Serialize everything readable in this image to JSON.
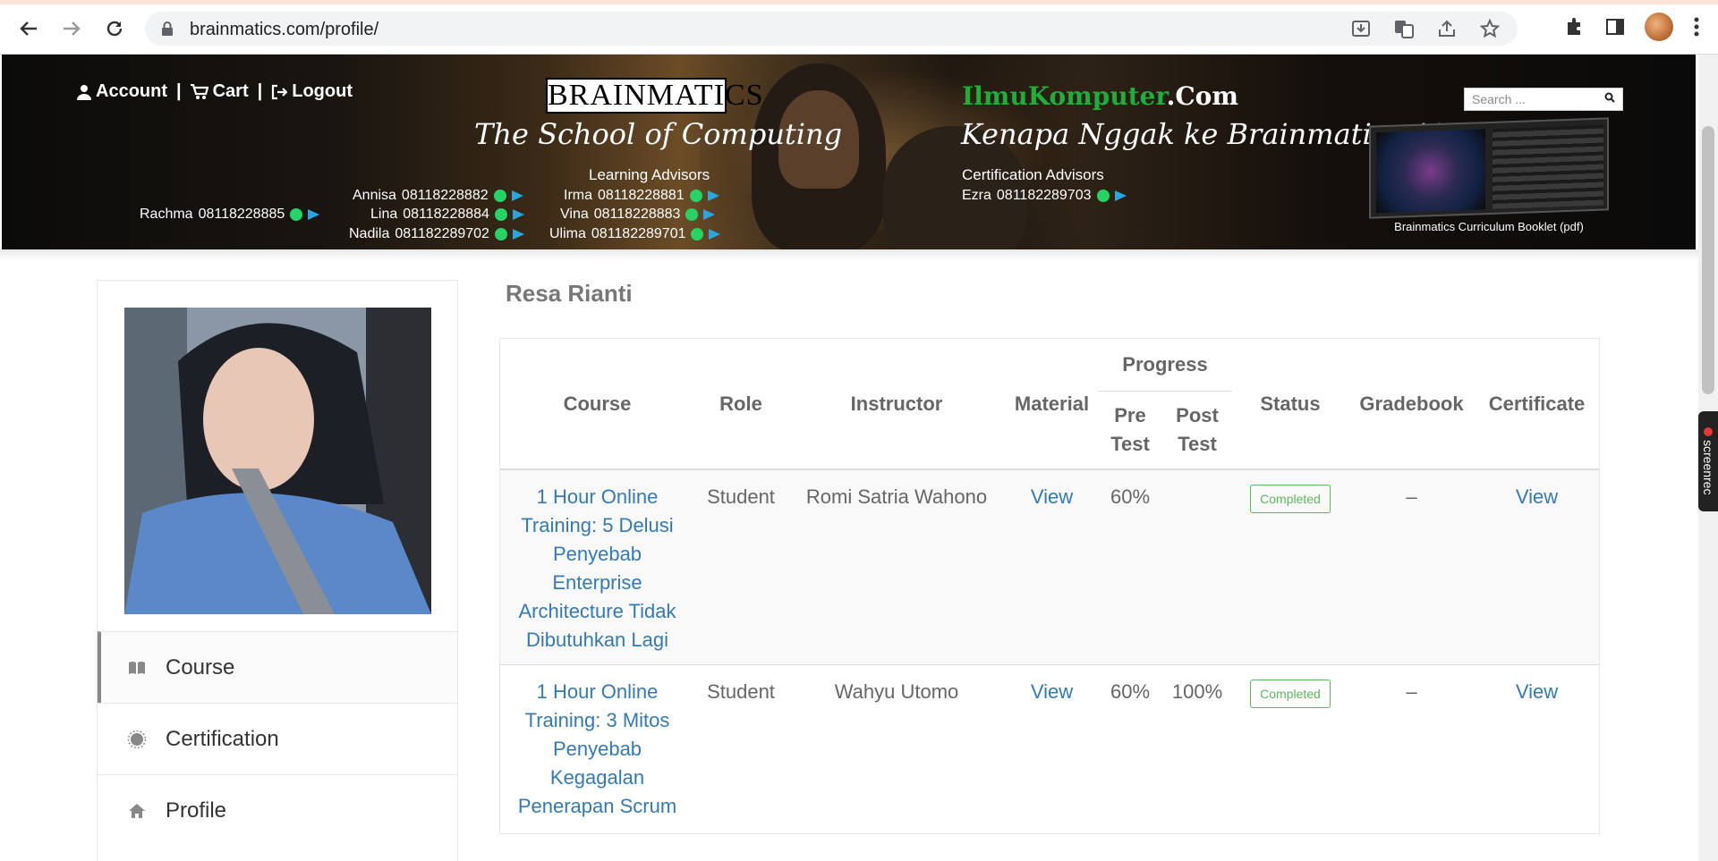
{
  "browser": {
    "url": "brainmatics.com/profile/",
    "icons": [
      "back-icon",
      "forward-icon",
      "reload-icon",
      "lock-icon",
      "install-icon",
      "translate-icon",
      "share-icon",
      "bookmark-star-icon",
      "extensions-icon",
      "side-panel-icon",
      "profile-avatar",
      "menu-icon"
    ]
  },
  "header": {
    "account": "Account",
    "cart": "Cart",
    "logout": "Logout",
    "sep1": "|",
    "sep2": "|",
    "logo": "BRAINMATICS",
    "tagline_left": "The School of Computing",
    "ilmu_green": "IlmuKomputer",
    "ilmu_white": ".Com",
    "tagline_right": "Kenapa Nggak ke Brainmatics Aja?",
    "learning_title": "Learning Advisors",
    "advisors": [
      {
        "name": "Annisa",
        "phone": "08118228882"
      },
      {
        "name": "Lina",
        "phone": "08118228884"
      },
      {
        "name": "Nadila",
        "phone": "081182289702"
      },
      {
        "name": "Irma",
        "phone": "08118228881"
      },
      {
        "name": "Vina",
        "phone": "08118228883"
      },
      {
        "name": "Ulima",
        "phone": "081182289701"
      },
      {
        "name": "Rachma",
        "phone": "08118228885"
      }
    ],
    "cert_title": "Certification Advisors",
    "cert_advisor": {
      "name": "Ezra",
      "phone": "081182289703"
    },
    "search_placeholder": "Search ...",
    "booklet_caption": "Brainmatics Curriculum Booklet (pdf)"
  },
  "sidebar": {
    "menu": [
      {
        "label": "Course",
        "icon": "book-icon"
      },
      {
        "label": "Certification",
        "icon": "certificate-icon"
      },
      {
        "label": "Profile",
        "icon": "home-icon"
      }
    ]
  },
  "profile": {
    "name": "Resa Rianti"
  },
  "table": {
    "headers": {
      "course": "Course",
      "role": "Role",
      "instructor": "Instructor",
      "material": "Material",
      "progress": "Progress",
      "pre_test_1": "Pre",
      "pre_test_2": "Test",
      "post_test_1": "Post",
      "post_test_2": "Test",
      "status": "Status",
      "gradebook": "Gradebook",
      "certificate": "Certificate"
    },
    "rows": [
      {
        "course_lines": [
          "1 Hour Online",
          "Training: 5 Delusi",
          "Penyebab",
          "Enterprise",
          "Architecture Tidak",
          "Dibutuhkan Lagi"
        ],
        "role": "Student",
        "instructor": "Romi Satria Wahono",
        "material": "View",
        "pre_test": "60%",
        "post_test": "",
        "status": "Completed",
        "gradebook": "–",
        "certificate": "View"
      },
      {
        "course_lines": [
          "1 Hour Online",
          "Training: 3 Mitos",
          "Penyebab",
          "Kegagalan",
          "Penerapan Scrum"
        ],
        "role": "Student",
        "instructor": "Wahyu Utomo",
        "material": "View",
        "pre_test": "60%",
        "post_test": "100%",
        "status": "Completed",
        "gradebook": "–",
        "certificate": "View"
      }
    ]
  },
  "overlay": {
    "screenrec": "screenrec"
  },
  "colors": {
    "link": "#337ab7",
    "completed": "#5cb85c",
    "ilmu_green": "#1fae3a"
  }
}
